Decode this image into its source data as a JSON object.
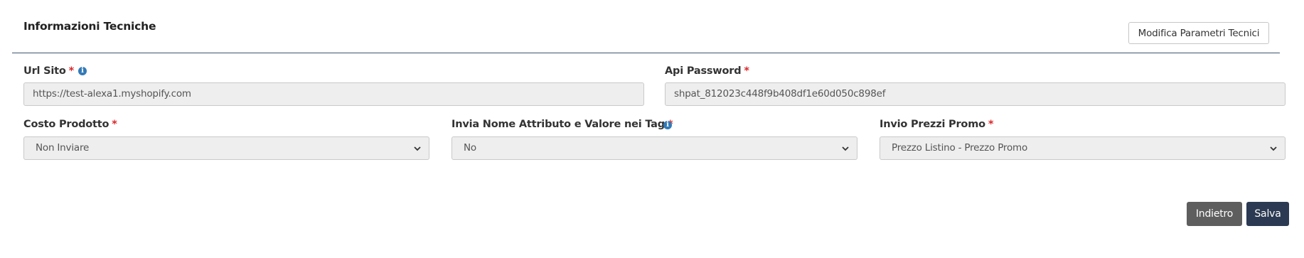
{
  "panel": {
    "title": "Informazioni Tecniche",
    "edit_button": "Modifica Parametri Tecnici"
  },
  "fields": {
    "url_sito": {
      "label": "Url Sito",
      "required_mark": "*",
      "value": "https://test-alexa1.myshopify.com"
    },
    "api_password": {
      "label": "Api Password",
      "required_mark": "*",
      "value": "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"
    },
    "costo_prodotto": {
      "label": "Costo Prodotto",
      "required_mark": "*",
      "selected": "Non Inviare"
    },
    "invia_nome_attributo": {
      "label": "Invia Nome Attributo e Valore nei Tag",
      "required_mark": "*",
      "selected": "No"
    },
    "invio_prezzi_promo": {
      "label": "Invio Prezzi Promo",
      "required_mark": "*",
      "selected": "Prezzo Listino - Prezzo Promo"
    }
  },
  "actions": {
    "back_label": "Indietro",
    "save_label": "Salva"
  },
  "icons": {
    "info": "info-icon",
    "dropdown": "chevron-down-icon"
  },
  "colors": {
    "required": "#d9262a",
    "info": "#337ab7",
    "divider": "#3f5570",
    "back_button": "#5e5e5e",
    "save_button": "#2b3a52"
  }
}
